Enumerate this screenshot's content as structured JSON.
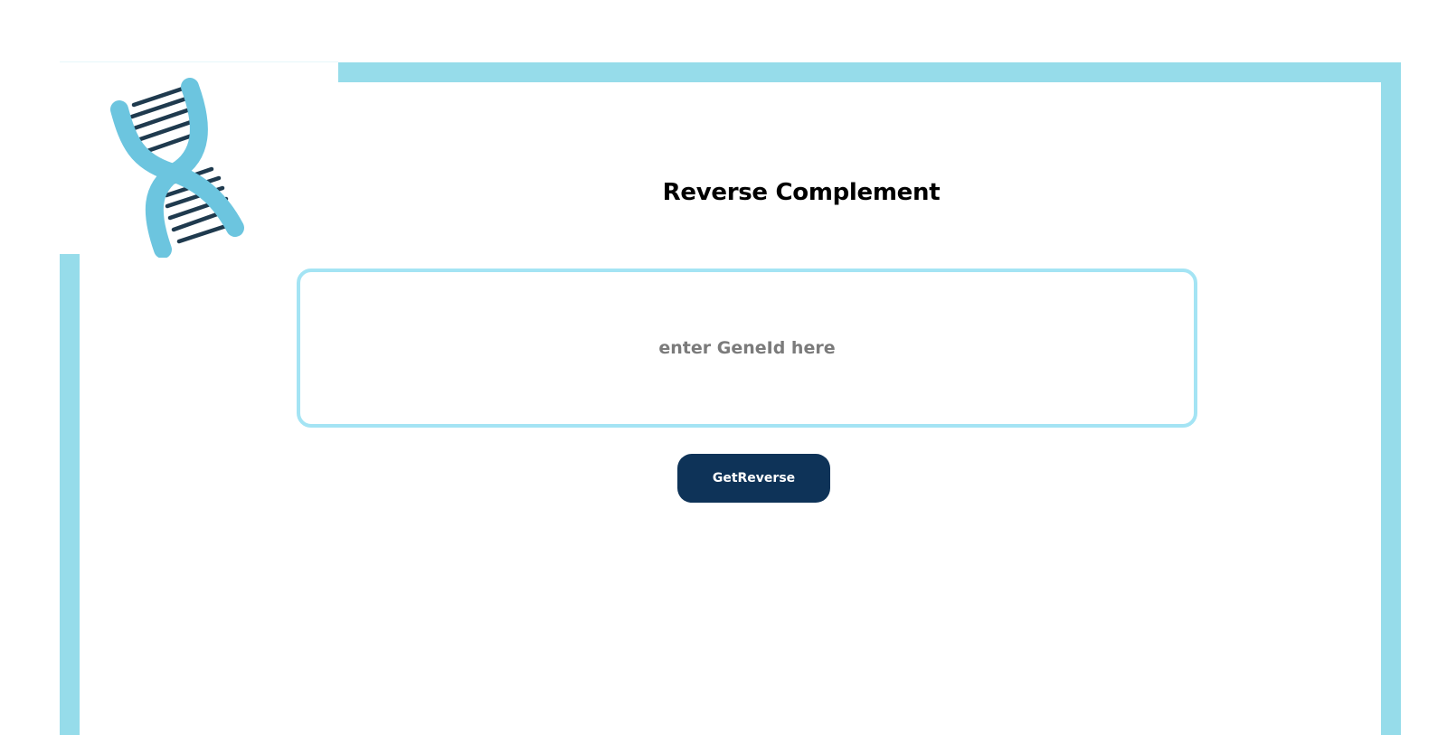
{
  "header": {
    "title": "Reverse Complement"
  },
  "form": {
    "gene_input": {
      "value": "",
      "placeholder": "enter GeneId here"
    },
    "submit_label": "GetReverse"
  },
  "colors": {
    "frame": "#96dcea",
    "input_border": "#a4e4f4",
    "button_bg": "#0e3358",
    "logo_strand": "#6cc5df",
    "logo_rungs": "#1f3a4e"
  },
  "icons": {
    "logo": "dna-icon"
  }
}
